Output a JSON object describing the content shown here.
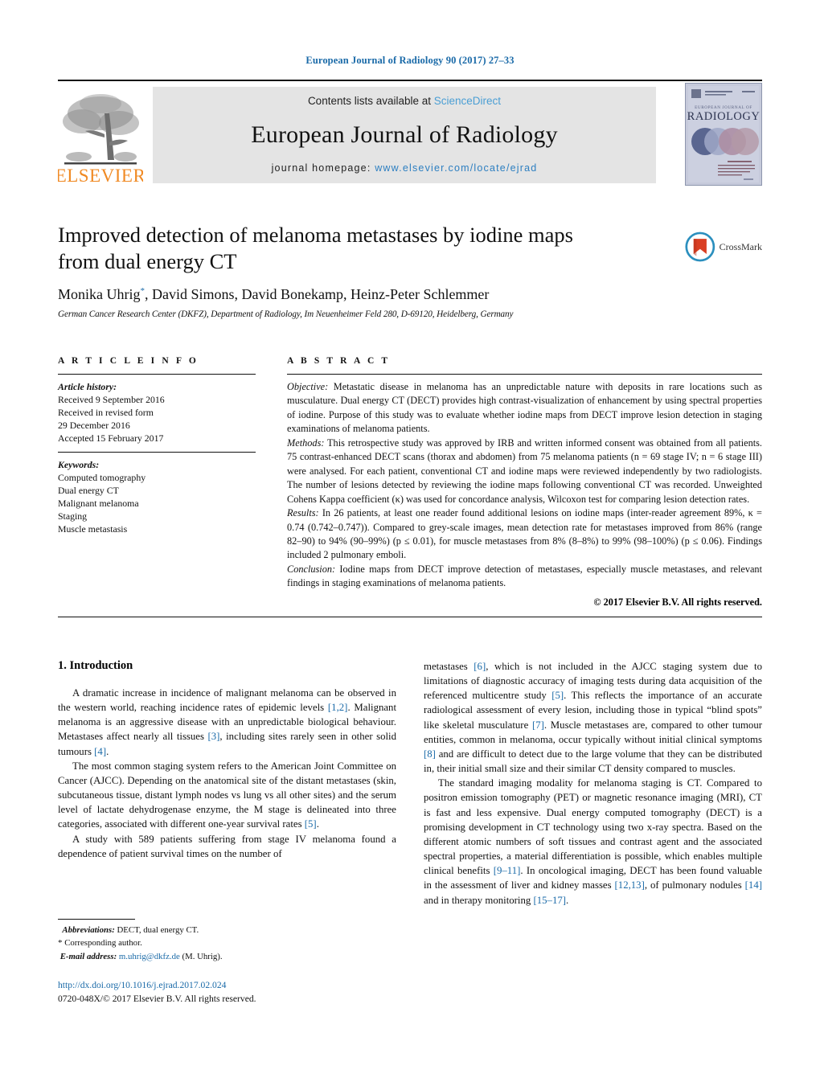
{
  "running_head": "European Journal of Radiology 90 (2017) 27–33",
  "masthead": {
    "contents_prefix": "Contents lists available at ",
    "sciencedirect": "ScienceDirect",
    "journal_title": "European Journal of Radiology",
    "homepage_prefix": "journal homepage: ",
    "homepage_url": "www.elsevier.com/locate/ejrad",
    "publisher_logo_text": "ELSEVIER",
    "cover_title": "RADIOLOGY",
    "cover_supertitle": "EUROPEAN JOURNAL OF",
    "link_color": "#2d7fc1",
    "band_color": "#e4e4e4"
  },
  "article": {
    "title": "Improved detection of melanoma metastases by iodine maps from dual energy CT",
    "authors": "Monika Uhrig, David Simons, David Bonekamp, Heinz-Peter Schlemmer",
    "corresponding_marker": "*",
    "affiliation": "German Cancer Research Center (DKFZ), Department of Radiology, Im Neuenheimer Feld 280, D-69120, Heidelberg, Germany",
    "crossmark_label": "CrossMark"
  },
  "info": {
    "heading": "A R T I C L E   I N F O",
    "history_label": "Article history:",
    "history": [
      "Received 9 September 2016",
      "Received in revised form",
      "29 December 2016",
      "Accepted 15 February 2017"
    ],
    "keywords_label": "Keywords:",
    "keywords": [
      "Computed tomography",
      "Dual energy CT",
      "Malignant melanoma",
      "Staging",
      "Muscle metastasis"
    ]
  },
  "abstract": {
    "heading": "A B S T R A C T",
    "sections": [
      {
        "label": "Objective:",
        "text": " Metastatic disease in melanoma has an unpredictable nature with deposits in rare locations such as musculature. Dual energy CT (DECT) provides high contrast-visualization of enhancement by using spectral properties of iodine. Purpose of this study was to evaluate whether iodine maps from DECT improve lesion detection in staging examinations of melanoma patients."
      },
      {
        "label": "Methods:",
        "text": " This retrospective study was approved by IRB and written informed consent was obtained from all patients. 75 contrast-enhanced DECT scans (thorax and abdomen) from 75 melanoma patients (n = 69 stage IV; n = 6 stage III) were analysed. For each patient, conventional CT and iodine maps were reviewed independently by two radiologists. The number of lesions detected by reviewing the iodine maps following conventional CT was recorded. Unweighted Cohens Kappa coefficient (κ) was used for concordance analysis, Wilcoxon test for comparing lesion detection rates."
      },
      {
        "label": "Results:",
        "text": " In 26 patients, at least one reader found additional lesions on iodine maps (inter-reader agreement 89%, κ = 0.74 (0.742–0.747)). Compared to grey-scale images, mean detection rate for metastases improved from 86% (range 82–90) to 94% (90–99%) (p ≤ 0.01), for muscle metastases from 8% (8–8%) to 99% (98–100%) (p ≤ 0.06). Findings included 2 pulmonary emboli."
      },
      {
        "label": "Conclusion:",
        "text": " Iodine maps from DECT improve detection of metastases, especially muscle metastases, and relevant findings in staging examinations of melanoma patients."
      }
    ],
    "copyright": "© 2017 Elsevier B.V. All rights reserved."
  },
  "body": {
    "section_number": "1.",
    "section_title": "Introduction",
    "left_paragraphs": [
      {
        "parts": [
          {
            "t": "A dramatic increase in incidence of malignant melanoma can be observed in the western world, reaching incidence rates of epidemic levels "
          },
          {
            "t": "[1,2]",
            "ref": true
          },
          {
            "t": ". Malignant melanoma is an aggressive disease with an unpredictable biological behaviour. Metastases affect nearly all tissues "
          },
          {
            "t": "[3]",
            "ref": true
          },
          {
            "t": ", including sites rarely seen in other solid tumours "
          },
          {
            "t": "[4]",
            "ref": true
          },
          {
            "t": "."
          }
        ]
      },
      {
        "parts": [
          {
            "t": "The most common staging system refers to the American Joint Committee on Cancer (AJCC). Depending on the anatomical site of the distant metastases (skin, subcutaneous tissue, distant lymph nodes vs lung vs all other sites) and the serum level of lactate dehydrogenase enzyme, the M stage is delineated into three categories, associated with different one-year survival rates "
          },
          {
            "t": "[5]",
            "ref": true
          },
          {
            "t": "."
          }
        ]
      },
      {
        "parts": [
          {
            "t": "A study with 589 patients suffering from stage IV melanoma found a dependence of patient survival times on the number of"
          }
        ]
      }
    ],
    "right_paragraphs": [
      {
        "noindent": true,
        "parts": [
          {
            "t": "metastases "
          },
          {
            "t": "[6]",
            "ref": true
          },
          {
            "t": ", which is not included in the AJCC staging system due to limitations of diagnostic accuracy of imaging tests during data acquisition of the referenced multicentre study "
          },
          {
            "t": "[5]",
            "ref": true
          },
          {
            "t": ". This reflects the importance of an accurate radiological assessment of every lesion, including those in typical “blind spots” like skeletal musculature "
          },
          {
            "t": "[7]",
            "ref": true
          },
          {
            "t": ". Muscle metastases are, compared to other tumour entities, common in melanoma, occur typically without initial clinical symptoms "
          },
          {
            "t": "[8]",
            "ref": true
          },
          {
            "t": " and are difficult to detect due to the large volume that they can be distributed in, their initial small size and their similar CT density compared to muscles."
          }
        ]
      },
      {
        "parts": [
          {
            "t": "The standard imaging modality for melanoma staging is CT. Compared to positron emission tomography (PET) or magnetic resonance imaging (MRI), CT is fast and less expensive. Dual energy computed tomography (DECT) is a promising development in CT technology using two x-ray spectra. Based on the different atomic numbers of soft tissues and contrast agent and the associated spectral properties, a material differentiation is possible, which enables multiple clinical benefits "
          },
          {
            "t": "[9–11]",
            "ref": true
          },
          {
            "t": ". In oncological imaging, DECT has been found valuable in the assessment of liver and kidney masses "
          },
          {
            "t": "[12,13]",
            "ref": true
          },
          {
            "t": ", of pulmonary nodules "
          },
          {
            "t": "[14]",
            "ref": true
          },
          {
            "t": " and in therapy monitoring "
          },
          {
            "t": "[15–17]",
            "ref": true
          },
          {
            "t": "."
          }
        ]
      }
    ]
  },
  "footer": {
    "abbrev_label": "Abbreviations:",
    "abbrev_text": " DECT, dual energy CT.",
    "corresponding_author": "Corresponding author.",
    "email_label": "E-mail address:",
    "email": "m.uhrig@dkfz.de",
    "email_suffix": " (M. Uhrig).",
    "doi": "http://dx.doi.org/10.1016/j.ejrad.2017.02.024",
    "issn_line": "0720-048X/© 2017 Elsevier B.V. All rights reserved."
  }
}
